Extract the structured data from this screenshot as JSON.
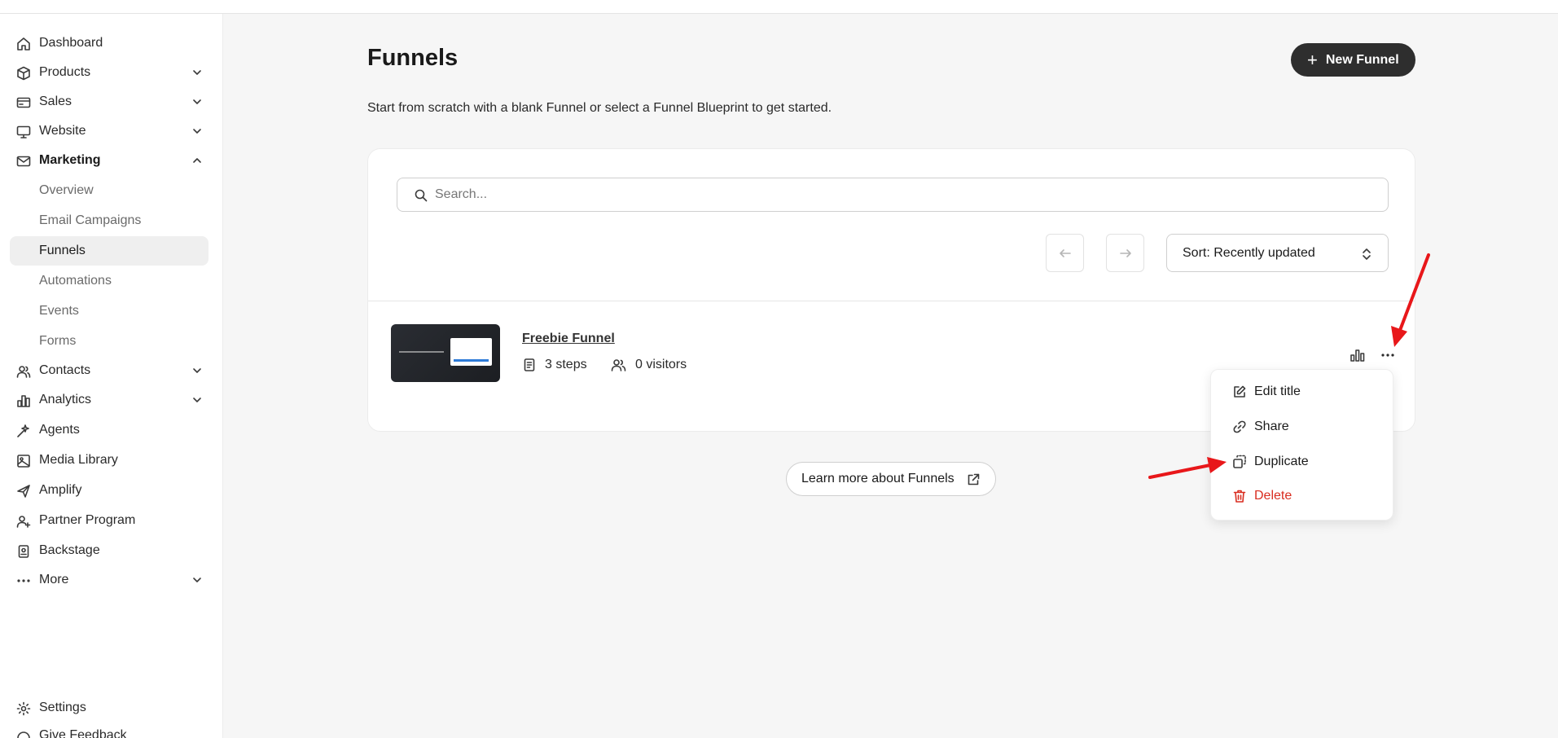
{
  "sidebar": {
    "items": [
      {
        "label": "Dashboard",
        "icon": "home-icon"
      },
      {
        "label": "Products",
        "icon": "box-icon"
      },
      {
        "label": "Sales",
        "icon": "card-icon"
      },
      {
        "label": "Website",
        "icon": "monitor-icon"
      },
      {
        "label": "Marketing",
        "icon": "mail-icon"
      },
      {
        "label": "Contacts",
        "icon": "users-icon"
      },
      {
        "label": "Analytics",
        "icon": "chart-icon"
      },
      {
        "label": "Agents",
        "icon": "sparkle-icon"
      },
      {
        "label": "Media Library",
        "icon": "image-icon"
      },
      {
        "label": "Amplify",
        "icon": "send-icon"
      },
      {
        "label": "Partner Program",
        "icon": "user-plus-icon"
      },
      {
        "label": "Backstage",
        "icon": "badge-icon"
      },
      {
        "label": "More",
        "icon": "dots-icon"
      }
    ],
    "marketing_sub": [
      "Overview",
      "Email Campaigns",
      "Funnels",
      "Automations",
      "Events",
      "Forms"
    ],
    "settings": "Settings",
    "feedback": "Give Feedback"
  },
  "main": {
    "title": "Funnels",
    "subtitle": "Start from scratch with a blank Funnel or select a Funnel Blueprint to get started.",
    "new_button": "New Funnel",
    "search_placeholder": "Search...",
    "sort_label": "Sort: Recently updated",
    "learn_more": "Learn more about Funnels"
  },
  "funnel": {
    "name": "Freebie Funnel",
    "steps": "3 steps",
    "visitors": "0 visitors"
  },
  "menu": {
    "edit": "Edit title",
    "share": "Share",
    "duplicate": "Duplicate",
    "delete": "Delete"
  },
  "colors": {
    "accent_dark": "#2e2e2e",
    "danger": "#d92d20",
    "annotation_arrow": "#e8171a"
  }
}
